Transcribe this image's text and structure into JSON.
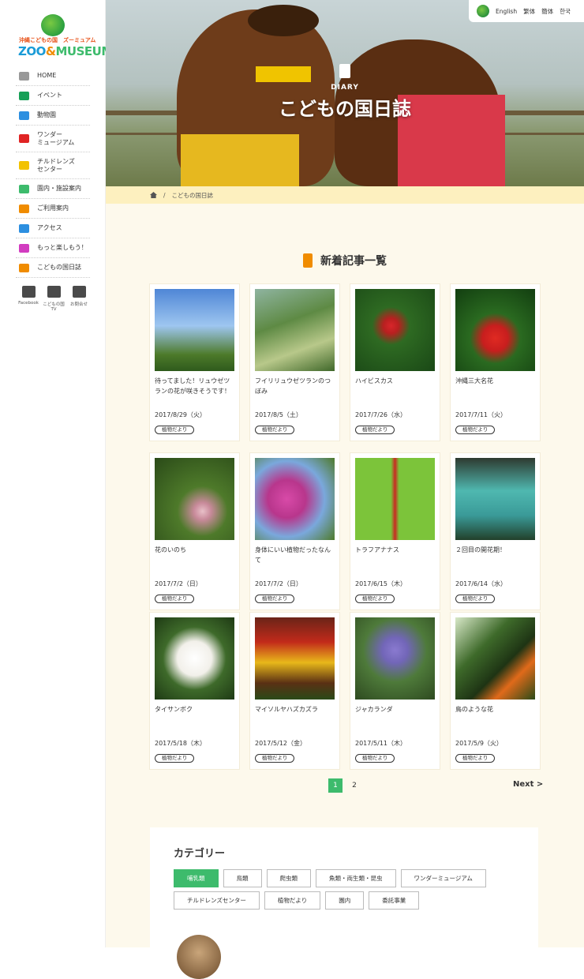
{
  "sidebar": {
    "logo": {
      "line1": "沖縄こどもの国",
      "line1b": "ズーミュアム",
      "line2a": "ZOO",
      "line2b": "&",
      "line2c": "MUSEUM"
    },
    "nav": [
      {
        "label": "HOME",
        "icon": "house-icon",
        "color": "#999999"
      },
      {
        "label": "イベント",
        "icon": "dragon-icon",
        "color": "#17a057"
      },
      {
        "label": "動物園",
        "icon": "elephant-icon",
        "color": "#2c8fe0"
      },
      {
        "label": "ワンダー\nミュージアム",
        "icon": "smile-face-icon",
        "color": "#e02424"
      },
      {
        "label": "チルドレンズ\nセンター",
        "icon": "helmet-icon",
        "color": "#f2c200"
      },
      {
        "label": "園内・施設案内",
        "icon": "map-icon",
        "color": "#3dbb6c"
      },
      {
        "label": "ご利用案内",
        "icon": "yen-icon",
        "color": "#f08c00"
      },
      {
        "label": "アクセス",
        "icon": "car-icon",
        "color": "#2c8fe0"
      },
      {
        "label": "もっと楽しもう！",
        "icon": "music-note-icon",
        "color": "#d23cc0"
      },
      {
        "label": "こどもの国日誌",
        "icon": "notebook-icon",
        "color": "#f08c00"
      }
    ],
    "social": [
      {
        "label": "Facebook",
        "icon": "facebook-icon"
      },
      {
        "label": "こどもの国TV",
        "icon": "tv-icon"
      },
      {
        "label": "お問合せ",
        "icon": "mail-icon"
      }
    ]
  },
  "hero": {
    "diary_label": "DIARY",
    "title": "こどもの国日誌"
  },
  "lang": [
    "English",
    "繁体",
    "簡体",
    "한국"
  ],
  "breadcrumb": {
    "separator": "/",
    "current": "こどもの国日誌"
  },
  "section_title": "新着記事一覧",
  "articles": [
    {
      "title": "待ってました！リュウゼツランの花が咲きそうです！",
      "date": "2017/8/29（火）",
      "tag": "植物だより",
      "photo": "linear-gradient(180deg,#4f86d6 0%,#9ec6f0 45%,#4d7a2a 80%,#2e5a1c 100%)"
    },
    {
      "title": "フイリリュウゼツランのつぼみ",
      "date": "2017/8/5（土）",
      "tag": "植物だより",
      "photo": "linear-gradient(160deg,#8fb4a0 0%,#5e8a44 40%,#b8c88a 70%,#40682a 100%)"
    },
    {
      "title": "ハイビスカス",
      "date": "2017/7/26（水）",
      "tag": "植物だより",
      "photo": "radial-gradient(circle at 45% 45%,#d8262a 0%,#b82020 12%,#2e6a22 30%,#1a4816 100%)"
    },
    {
      "title": "沖縄三大名花",
      "date": "2017/7/11（火）",
      "tag": "植物だより",
      "photo": "radial-gradient(circle at 50% 60%,#e02a22 0%,#c81e1e 20%,#2a6a20 40%,#123e10 100%)"
    },
    {
      "title": "花のいのち",
      "date": "2017/7/2（日）",
      "tag": "植物だより",
      "photo": "radial-gradient(circle at 60% 65%,#e8c0c8 0%,#c88a9a 12%,#4e7a2a 35%,#2a4a18 100%)"
    },
    {
      "title": "身体にいい植物だったなんて",
      "date": "2017/7/2（日）",
      "tag": "植物だより",
      "photo": "radial-gradient(circle at 40% 50%,#d84aa8 0%,#b8368c 30%,#7aa8dc 60%,#4e7a2a 100%)"
    },
    {
      "title": "トラフアナナス",
      "date": "2017/6/15（木）",
      "tag": "植物だより",
      "photo": "linear-gradient(90deg,#7cc43a 0%,#7cc43a 45%,#c82a22 50%,#7cc43a 55%,#7cc43a 100%)"
    },
    {
      "title": "２回目の開花期！",
      "date": "2017/6/14（水）",
      "tag": "植物だより",
      "photo": "linear-gradient(180deg,#2e3a30 0%,#4fb8b0 40%,#3a9a98 70%,#22402a 100%)"
    },
    {
      "title": "タイサンボク",
      "date": "2017/5/18（木）",
      "tag": "植物だより",
      "photo": "radial-gradient(circle at 50% 50%,#ffffff 0%,#f2f0ea 30%,#3e6a2a 55%,#1e3a14 100%)"
    },
    {
      "title": "マイソルヤハズカズラ",
      "date": "2017/5/12（金）",
      "tag": "植物だより",
      "photo": "linear-gradient(180deg,#6a2418 0%,#c22a1a 30%,#e8b81a 55%,#5a3014 80%,#2a4a18 100%)"
    },
    {
      "title": "ジャカランダ",
      "date": "2017/5/11（木）",
      "tag": "植物だより",
      "photo": "radial-gradient(circle at 50% 40%,#8a7ad0 0%,#7266b8 20%,#4e7a3a 50%,#2e4a20 100%)"
    },
    {
      "title": "鳥のような花",
      "date": "2017/5/9（火）",
      "tag": "植物だより",
      "photo": "linear-gradient(135deg,#d8e8c8 0%,#3e6a2a 35%,#1e3414 60%,#e06a1a 75%,#2a4a18 100%)"
    }
  ],
  "pagination": {
    "pages": [
      "1",
      "2"
    ],
    "current": "1",
    "next": "Next >"
  },
  "category": {
    "title": "カテゴリー",
    "items": [
      "哺乳類",
      "鳥類",
      "爬虫類",
      "魚類・両生類・昆虫",
      "ワンダーミュージアム",
      "チルドレンズセンター",
      "植物だより",
      "園内",
      "委託事業"
    ],
    "active": "哺乳類"
  }
}
